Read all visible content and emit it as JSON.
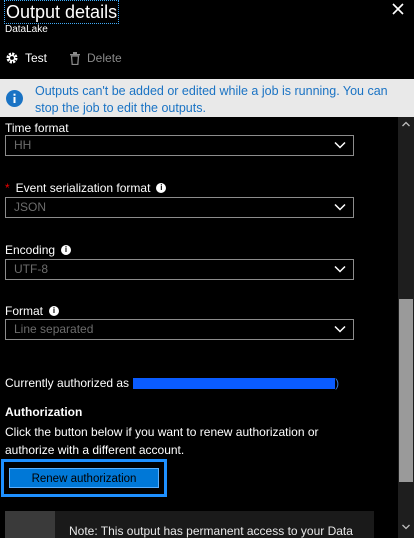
{
  "header": {
    "title": "Output details",
    "subtitle": "DataLake",
    "close_icon": "close-icon"
  },
  "toolbar": {
    "test_label": "Test",
    "delete_label": "Delete"
  },
  "info_banner": {
    "text": "Outputs can't be added or edited while a job is running. You can stop the job to edit the outputs."
  },
  "fields": {
    "time_format": {
      "label": "Time format",
      "value": "HH"
    },
    "event_serialization": {
      "label": "Event serialization format",
      "value": "JSON"
    },
    "encoding": {
      "label": "Encoding",
      "value": "UTF-8"
    },
    "format": {
      "label": "Format",
      "value": "Line separated"
    }
  },
  "authorization": {
    "current_label": "Currently authorized as",
    "heading": "Authorization",
    "description": "Click the button below if you want to renew authorization or authorize with a different account.",
    "renew_button": "Renew authorization"
  },
  "note": {
    "text": "Note: This output has permanent access to your Data"
  },
  "colors": {
    "background": "#000000",
    "banner_bg": "#e9e9e9",
    "banner_text": "#1a73c4",
    "button_bg": "#0078d7",
    "required": "#ee0000"
  }
}
